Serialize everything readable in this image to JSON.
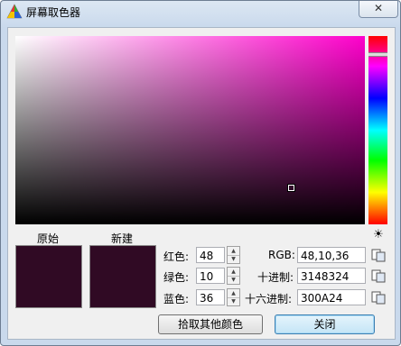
{
  "window": {
    "title": "屏幕取色器",
    "close_glyph": "✕"
  },
  "swatches": {
    "original_label": "原始",
    "new_label": "新建",
    "color": "#300A24"
  },
  "picker": {
    "hue_base": "#ff00cc"
  },
  "rgb_fields": [
    {
      "label": "红色:",
      "value": "48"
    },
    {
      "label": "绿色:",
      "value": "10"
    },
    {
      "label": "蓝色:",
      "value": "36"
    }
  ],
  "formats": [
    {
      "label": "RGB:",
      "value": "48,10,36"
    },
    {
      "label": "十进制:",
      "value": "3148324"
    },
    {
      "label": "十六进制:",
      "value": "300A24"
    }
  ],
  "buttons": {
    "pick_other": "拾取其他颜色",
    "close": "关闭"
  },
  "icons": {
    "sun": "☀",
    "spin_up": "▲",
    "spin_down": "▼"
  }
}
